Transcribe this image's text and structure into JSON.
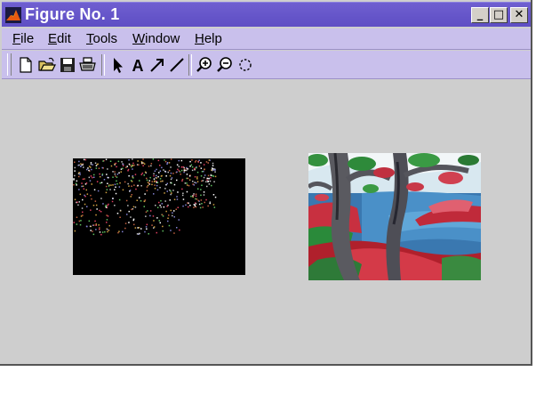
{
  "window": {
    "title": "Figure No. 1",
    "buttons": {
      "minimize": "_",
      "maximize": "□",
      "close": "✕"
    }
  },
  "menu": {
    "items": [
      {
        "accel": "F",
        "rest": "ile"
      },
      {
        "accel": "E",
        "rest": "dit"
      },
      {
        "accel": "T",
        "rest": "ools"
      },
      {
        "accel": "W",
        "rest": "indow"
      },
      {
        "accel": "H",
        "rest": "elp"
      }
    ]
  },
  "toolbar": {
    "tools": [
      "new-file-icon",
      "open-folder-icon",
      "save-icon",
      "print-icon",
      "select-arrow-icon",
      "insert-text-icon",
      "insert-arrow-icon",
      "insert-line-icon",
      "zoom-in-icon",
      "zoom-out-icon",
      "rotate-icon"
    ],
    "text_tool_glyph": "A"
  },
  "colors": {
    "titlebar": "#5e4ec4",
    "menubar": "#c9c0ec",
    "figure_background": "#cecece"
  }
}
